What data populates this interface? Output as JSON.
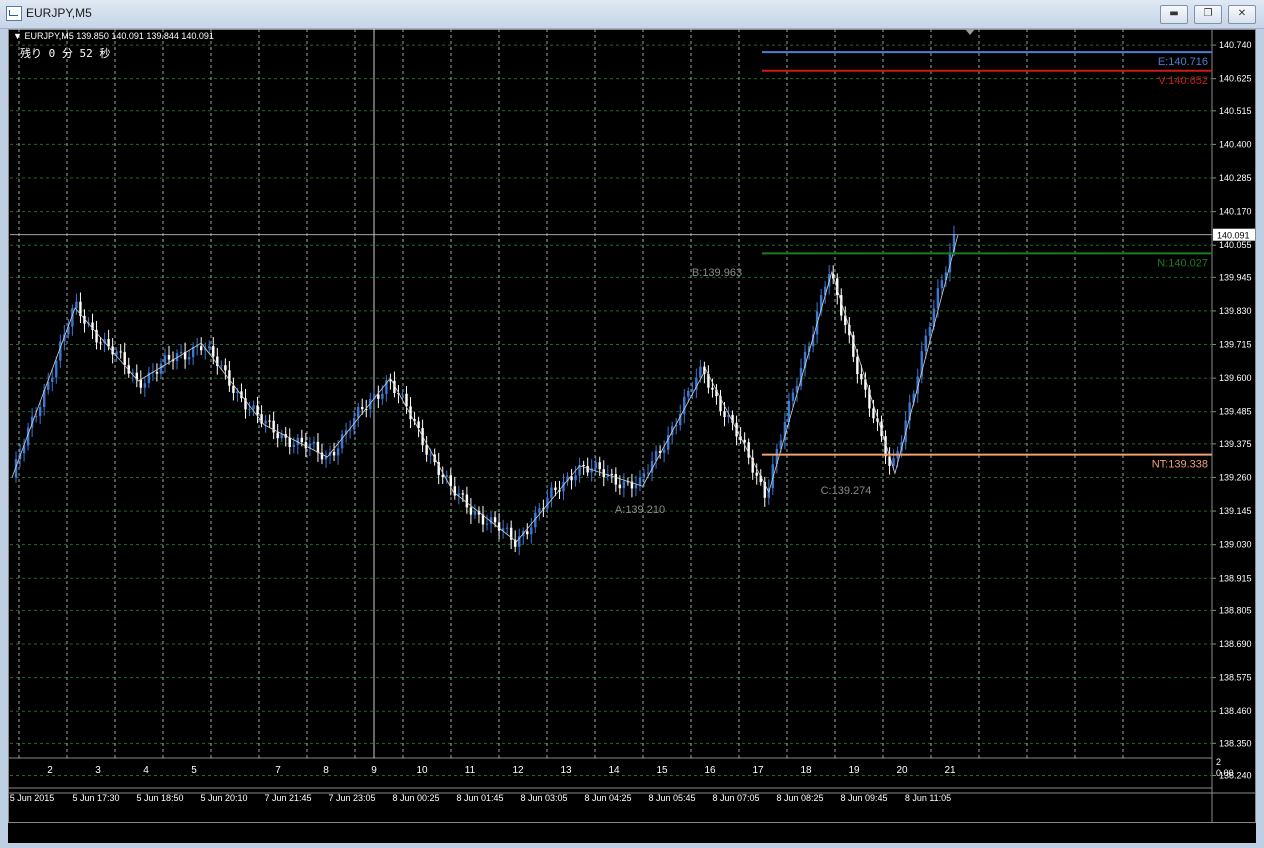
{
  "window": {
    "title": "EURJPY,M5",
    "minimize_icon": "minimize-icon",
    "maximize_icon": "restore-icon",
    "close_icon": "close-icon"
  },
  "chart_header": {
    "symbol_info": "EURJPY,M5  139.850 140.091 139.844 140.091",
    "countdown": "残り 0 分 52 秒"
  },
  "colors": {
    "background": "#000000",
    "bull": "#3a78d4",
    "bear": "#ffffff",
    "grid": "#1f6b1f",
    "line_E": "#4a7fd6",
    "line_V": "#d01818",
    "line_N": "#1e7a1e",
    "line_NT": "#f0a070"
  },
  "chart_data": {
    "type": "candlestick",
    "symbol": "EURJPY,M5",
    "ylim": [
      138.18,
      140.795
    ],
    "price_ticks": [
      "140.740",
      "140.625",
      "140.515",
      "140.400",
      "140.285",
      "140.170",
      "140.055",
      "139.945",
      "139.830",
      "139.715",
      "139.600",
      "139.485",
      "139.375",
      "139.260",
      "139.145",
      "139.030",
      "138.915",
      "138.805",
      "138.690",
      "138.575",
      "138.460",
      "138.350",
      "138.240"
    ],
    "current_price": "140.091",
    "time_ticks": [
      "5 Jun 2015",
      "5 Jun 17:30",
      "5 Jun 18:50",
      "5 Jun 20:10",
      "7 Jun 21:45",
      "7 Jun 23:05",
      "8 Jun 00:25",
      "8 Jun 01:45",
      "8 Jun 03:05",
      "8 Jun 04:25",
      "8 Jun 05:45",
      "8 Jun 07:05",
      "8 Jun 08:25",
      "8 Jun 09:45",
      "8 Jun 11:05"
    ],
    "indicator_ticks": [
      "2",
      "3",
      "4",
      "5",
      "7",
      "8",
      "9",
      "10",
      "11",
      "12",
      "13",
      "14",
      "15",
      "16",
      "17",
      "18",
      "19",
      "20",
      "21"
    ],
    "indicator_scale": [
      "2",
      "0.00"
    ],
    "horizontal_levels": [
      {
        "label": "E:140.716",
        "value": 140.716,
        "color": "#4a7fd6"
      },
      {
        "label": "V:140.652",
        "value": 140.652,
        "color": "#d01818"
      },
      {
        "label": "N:140.027",
        "value": 140.027,
        "color": "#1e7a1e"
      },
      {
        "label": "NT:139.338",
        "value": 139.338,
        "color": "#f0a070"
      }
    ],
    "points": [
      {
        "label": "A:139.210",
        "value": 139.21
      },
      {
        "label": "B:139.963",
        "value": 139.963
      },
      {
        "label": "C:139.274",
        "value": 139.274
      }
    ],
    "zigzag": [
      139.26,
      139.84,
      139.59,
      139.72,
      139.44,
      139.33,
      139.6,
      139.21,
      139.04,
      139.3,
      139.23,
      139.63,
      139.21,
      139.963,
      139.274,
      140.091
    ]
  }
}
